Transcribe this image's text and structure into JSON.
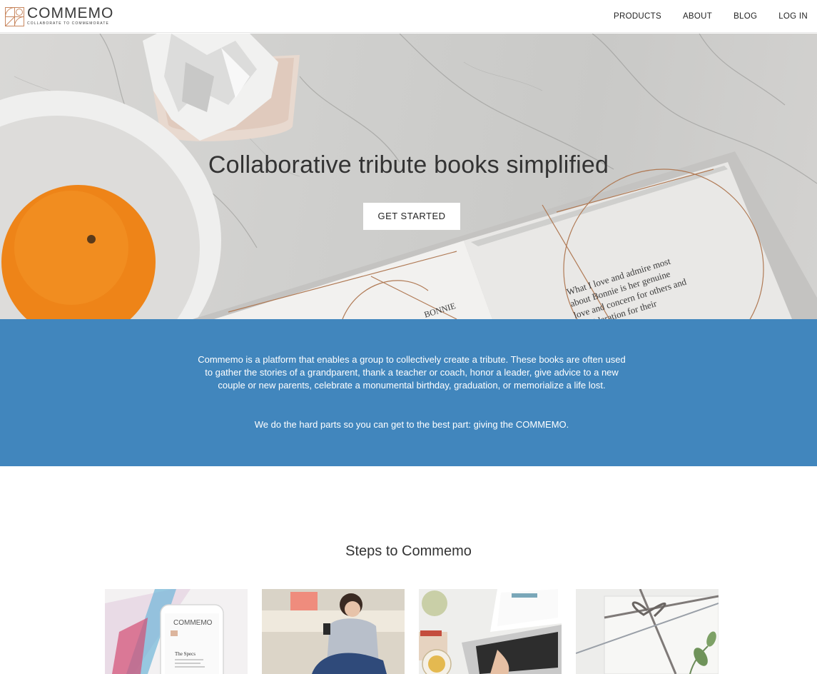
{
  "brand": {
    "name": "COMMEMO",
    "tagline": "COLLABORATE TO COMMEMORATE",
    "accent": "#c8875f"
  },
  "nav": {
    "items": [
      "PRODUCTS",
      "ABOUT",
      "BLOG",
      "LOG IN"
    ]
  },
  "hero": {
    "title": "Collaborative tribute books simplified",
    "cta_label": "GET STARTED",
    "book_text": "What I love and admire most about Bonnie is her genuine love and concern for others and consideration for their Bonnie",
    "book_name": "BONNIE"
  },
  "intro": {
    "paragraph": "Commemo is a platform that enables a group to collectively create a tribute. These books are often used to gather the stories of a grandparent, thank a teacher or coach, honor a leader, give advice to a new couple or new parents, celebrate a monumental birthday, graduation, or memorialize a life lost.",
    "tagline": "We do the hard parts so you can get to the best part: giving the COMMEMO.",
    "band_color": "#4186bd"
  },
  "steps": {
    "title": "Steps to Commemo",
    "phone_brand": "COMMEMO",
    "phone_heading": "The Specs"
  }
}
